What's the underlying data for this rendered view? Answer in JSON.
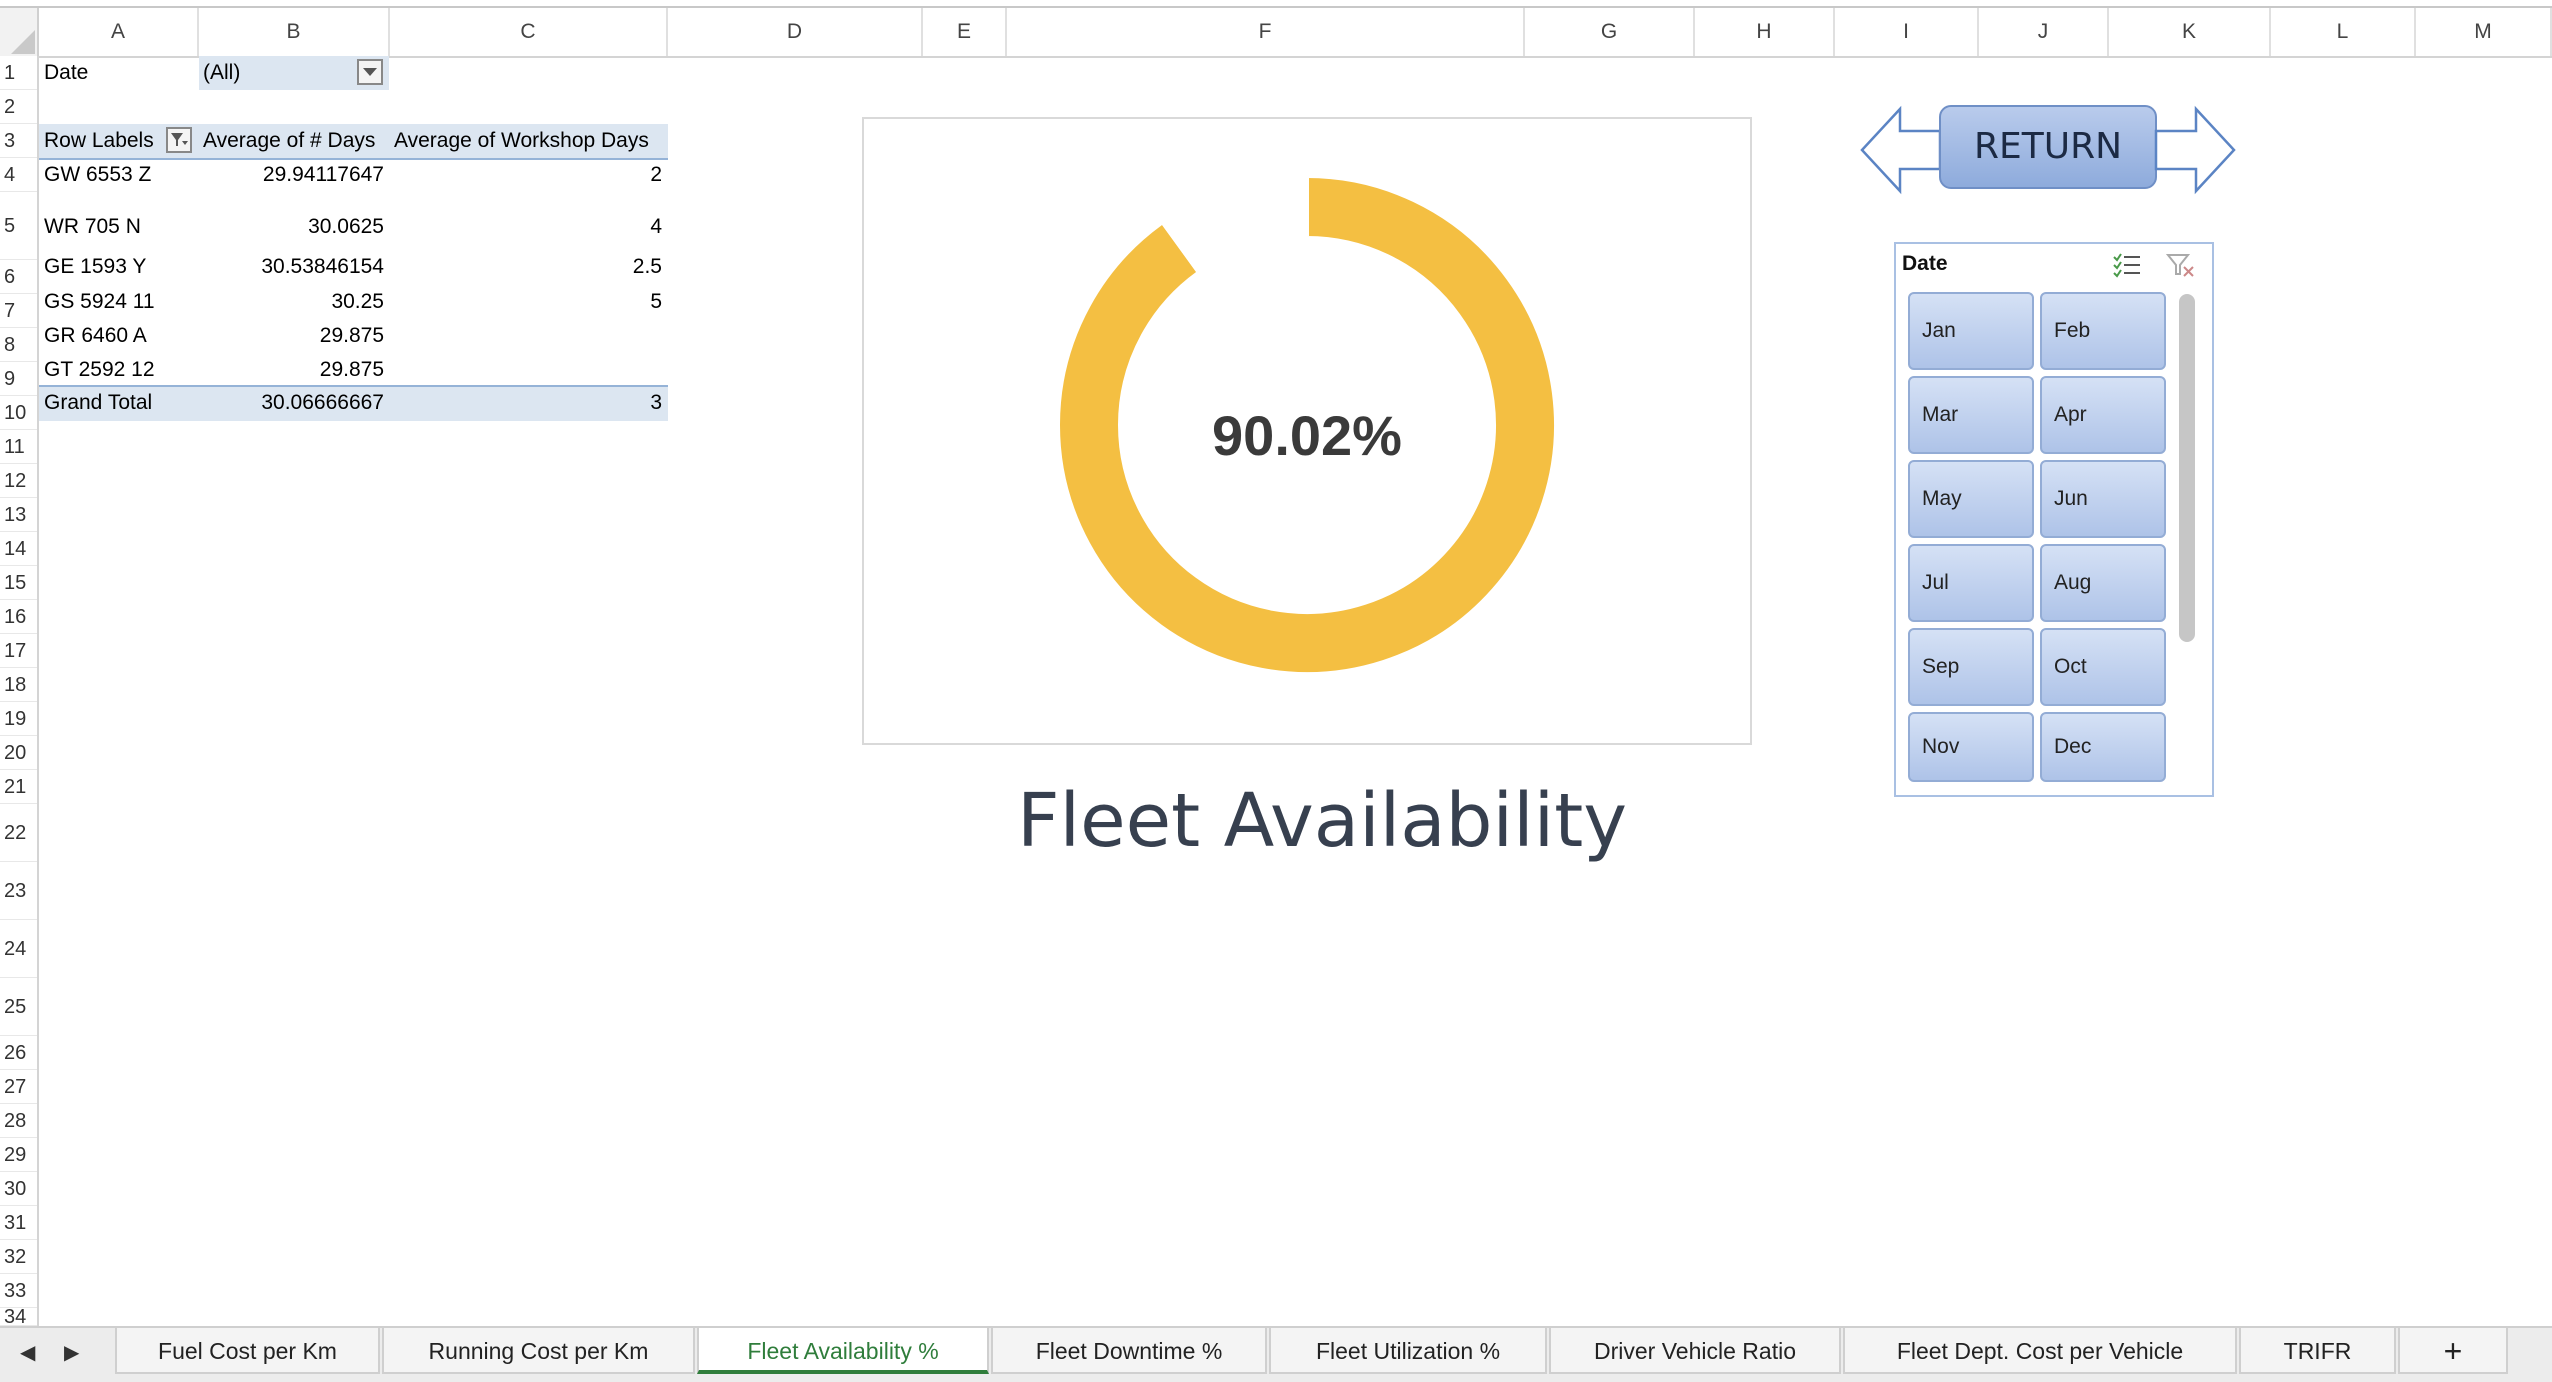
{
  "columns": [
    "A",
    "B",
    "C",
    "D",
    "E",
    "F",
    "G",
    "H",
    "I",
    "J",
    "K",
    "L",
    "M"
  ],
  "rows": [
    "1",
    "2",
    "3",
    "4",
    "5",
    "6",
    "7",
    "8",
    "9",
    "10",
    "11",
    "12",
    "13",
    "14",
    "15",
    "16",
    "17",
    "18",
    "19",
    "20",
    "21",
    "22",
    "23",
    "24",
    "25",
    "26",
    "27",
    "28",
    "29",
    "30",
    "31",
    "32",
    "33",
    "34"
  ],
  "pivot": {
    "filter_label": "Date",
    "filter_value": "(All)",
    "header": {
      "row_labels": "Row Labels",
      "avg_days": "Average of # Days",
      "avg_workshop": "Average of Workshop Days"
    },
    "rows": [
      {
        "label": "GW 6553 Z",
        "avg_days": "29.94117647",
        "avg_workshop": "2"
      },
      {
        "label": "WR 705 N",
        "avg_days": "30.0625",
        "avg_workshop": "4"
      },
      {
        "label": "GE 1593 Y",
        "avg_days": "30.53846154",
        "avg_workshop": "2.5"
      },
      {
        "label": "GS 5924 11",
        "avg_days": "30.25",
        "avg_workshop": "5"
      },
      {
        "label": "GR 6460 A",
        "avg_days": "29.875",
        "avg_workshop": ""
      },
      {
        "label": "GT 2592 12",
        "avg_days": "29.875",
        "avg_workshop": ""
      }
    ],
    "total": {
      "label": "Grand Total",
      "avg_days": "30.06666667",
      "avg_workshop": "3"
    }
  },
  "chart_data": {
    "type": "pie",
    "center_label": "90.02%",
    "values": [
      90.02,
      9.98
    ],
    "title": "Fleet Availability",
    "colors": [
      "#f4bf42",
      "#ffffff"
    ]
  },
  "return_button": {
    "label": "RETURN"
  },
  "slicer": {
    "title": "Date",
    "items": [
      "Jan",
      "Feb",
      "Mar",
      "Apr",
      "May",
      "Jun",
      "Jul",
      "Aug",
      "Sep",
      "Oct",
      "Nov",
      "Dec"
    ]
  },
  "tabs": [
    {
      "label": "Fuel Cost per Km",
      "active": false
    },
    {
      "label": "Running Cost per Km",
      "active": false
    },
    {
      "label": "Fleet Availability %",
      "active": true
    },
    {
      "label": "Fleet Downtime %",
      "active": false
    },
    {
      "label": "Fleet Utilization %",
      "active": false
    },
    {
      "label": "Driver Vehicle Ratio",
      "active": false
    },
    {
      "label": "Fleet Dept. Cost per Vehicle",
      "active": false
    },
    {
      "label": "TRIFR",
      "active": false
    }
  ],
  "colors": {
    "accent_tab": "#2f7d3b",
    "pivot_header": "#dce6f1",
    "donut": "#f4bf42"
  }
}
